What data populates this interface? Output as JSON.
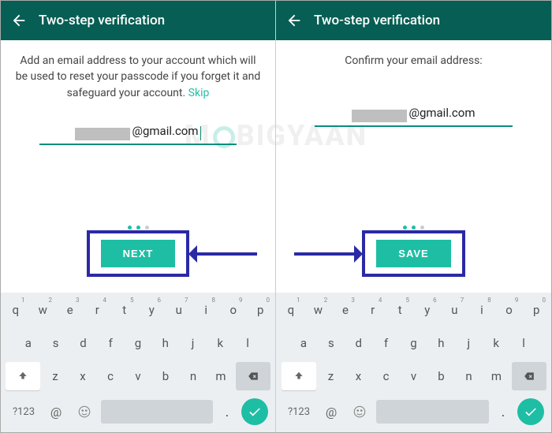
{
  "appbar": {
    "title": "Two-step verification"
  },
  "left": {
    "instruction_a": "Add an email address to your account which will",
    "instruction_b": "be used to reset your passcode if you forget it and",
    "instruction_c": "safeguard your account. ",
    "skip": "Skip",
    "email_visible": "@gmail.com",
    "cta": "NEXT"
  },
  "right": {
    "instruction": "Confirm your email address:",
    "email_visible": "@gmail.com",
    "cta": "SAVE"
  },
  "keyboard": {
    "row1": [
      {
        "k": "q",
        "n": "1"
      },
      {
        "k": "w",
        "n": "2"
      },
      {
        "k": "e",
        "n": "3"
      },
      {
        "k": "r",
        "n": "4"
      },
      {
        "k": "t",
        "n": "5"
      },
      {
        "k": "y",
        "n": "6"
      },
      {
        "k": "u",
        "n": "7"
      },
      {
        "k": "i",
        "n": "8"
      },
      {
        "k": "o",
        "n": "9"
      },
      {
        "k": "p",
        "n": "0"
      }
    ],
    "row2": [
      "a",
      "s",
      "d",
      "f",
      "g",
      "h",
      "j",
      "k",
      "l"
    ],
    "row3": [
      "z",
      "x",
      "c",
      "v",
      "b",
      "n",
      "m"
    ],
    "sym": "?123",
    "at": "@",
    "dot": "."
  },
  "watermark": "M  BIGYAAN"
}
